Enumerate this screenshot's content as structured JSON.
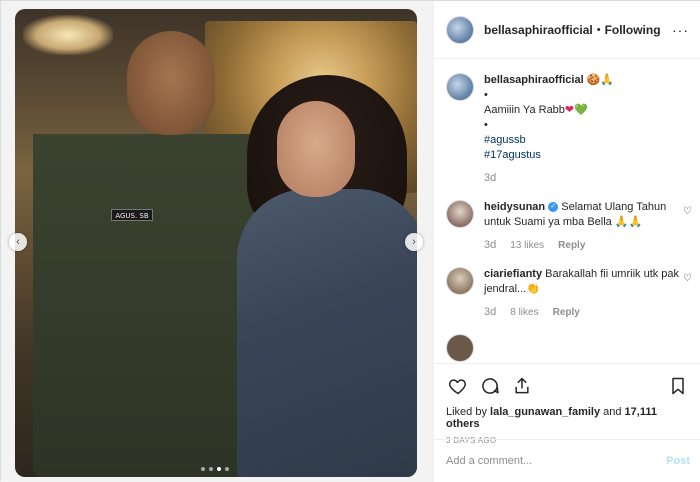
{
  "post": {
    "username": "bellasaphiraofficial",
    "separator": "•",
    "follow_label": "Following",
    "more_label": "···",
    "photo_name_tag": "AGUS. SB",
    "carousel": {
      "dots": 4,
      "active": 2
    }
  },
  "caption": {
    "username": "bellasaphiraofficial",
    "emoji": "🍪🙏",
    "bullet1": "•",
    "text_prefix": "Aamiiin Ya Rabb",
    "text_heart_red": "❤",
    "text_heart_green": "💚",
    "bullet2": "•",
    "tags": [
      "#agussb",
      "#17agustus"
    ],
    "time": "3d"
  },
  "comments": [
    {
      "username": "heidysunan",
      "verified_mark": "✓",
      "text": "Selamat Ulang Tahun untuk Suami ya mba Bella 🙏🙏",
      "time": "3d",
      "likes": "13 likes",
      "reply": "Reply"
    },
    {
      "username": "ciariefianty",
      "text": "Barakallah fii umriik utk pak jendral...👏",
      "time": "3d",
      "likes": "8 likes",
      "reply": "Reply"
    }
  ],
  "likes": {
    "prefix": "Liked by ",
    "user": "lala_gunawan_family",
    "middle": " and ",
    "count": "17,111 others"
  },
  "date_label": "3 DAYS AGO",
  "add_comment": {
    "placeholder": "Add a comment...",
    "post_label": "Post"
  }
}
